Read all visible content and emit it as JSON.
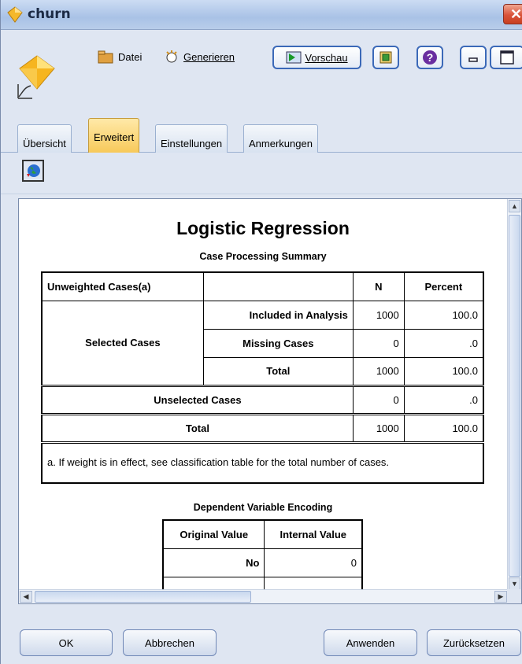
{
  "window": {
    "title": "churn"
  },
  "toolbar": {
    "file_label": "Datei",
    "generate_label": "Generieren",
    "preview_label": "Vorschau"
  },
  "tabs": [
    {
      "label": "Übersicht"
    },
    {
      "label": "Erweitert",
      "active": true
    },
    {
      "label": "Einstellungen"
    },
    {
      "label": "Anmerkungen"
    }
  ],
  "report": {
    "title": "Logistic Regression",
    "case_summary": {
      "title": "Case Processing Summary",
      "headers": [
        "Unweighted Cases(a)",
        "",
        "N",
        "Percent"
      ],
      "selected_label": "Selected Cases",
      "rows": [
        {
          "label": "Included in Analysis",
          "n": "1000",
          "percent": "100.0"
        },
        {
          "label": "Missing Cases",
          "n": "0",
          "percent": ".0"
        },
        {
          "label": "Total",
          "n": "1000",
          "percent": "100.0"
        }
      ],
      "unselected": {
        "label": "Unselected Cases",
        "n": "0",
        "percent": ".0"
      },
      "total": {
        "label": "Total",
        "n": "1000",
        "percent": "100.0"
      },
      "footnote": "a. If weight is in effect, see classification table for the total number of cases."
    },
    "encoding": {
      "title": "Dependent Variable Encoding",
      "headers": [
        "Original Value",
        "Internal Value"
      ],
      "rows": [
        {
          "original": "No",
          "internal": "0"
        }
      ]
    }
  },
  "buttons": {
    "ok": "OK",
    "cancel": "Abbrechen",
    "apply": "Anwenden",
    "reset": "Zurücksetzen"
  },
  "colors": {
    "window_bg": "#dfe6f2",
    "active_tab": "#f7c95a",
    "close_button": "#d9533a"
  },
  "icons": [
    "diamond-node-icon",
    "close-icon",
    "folder-icon",
    "generate-icon",
    "preview-icon",
    "export-icon",
    "help-icon",
    "minimize-icon",
    "maximize-icon",
    "globe-icon"
  ]
}
